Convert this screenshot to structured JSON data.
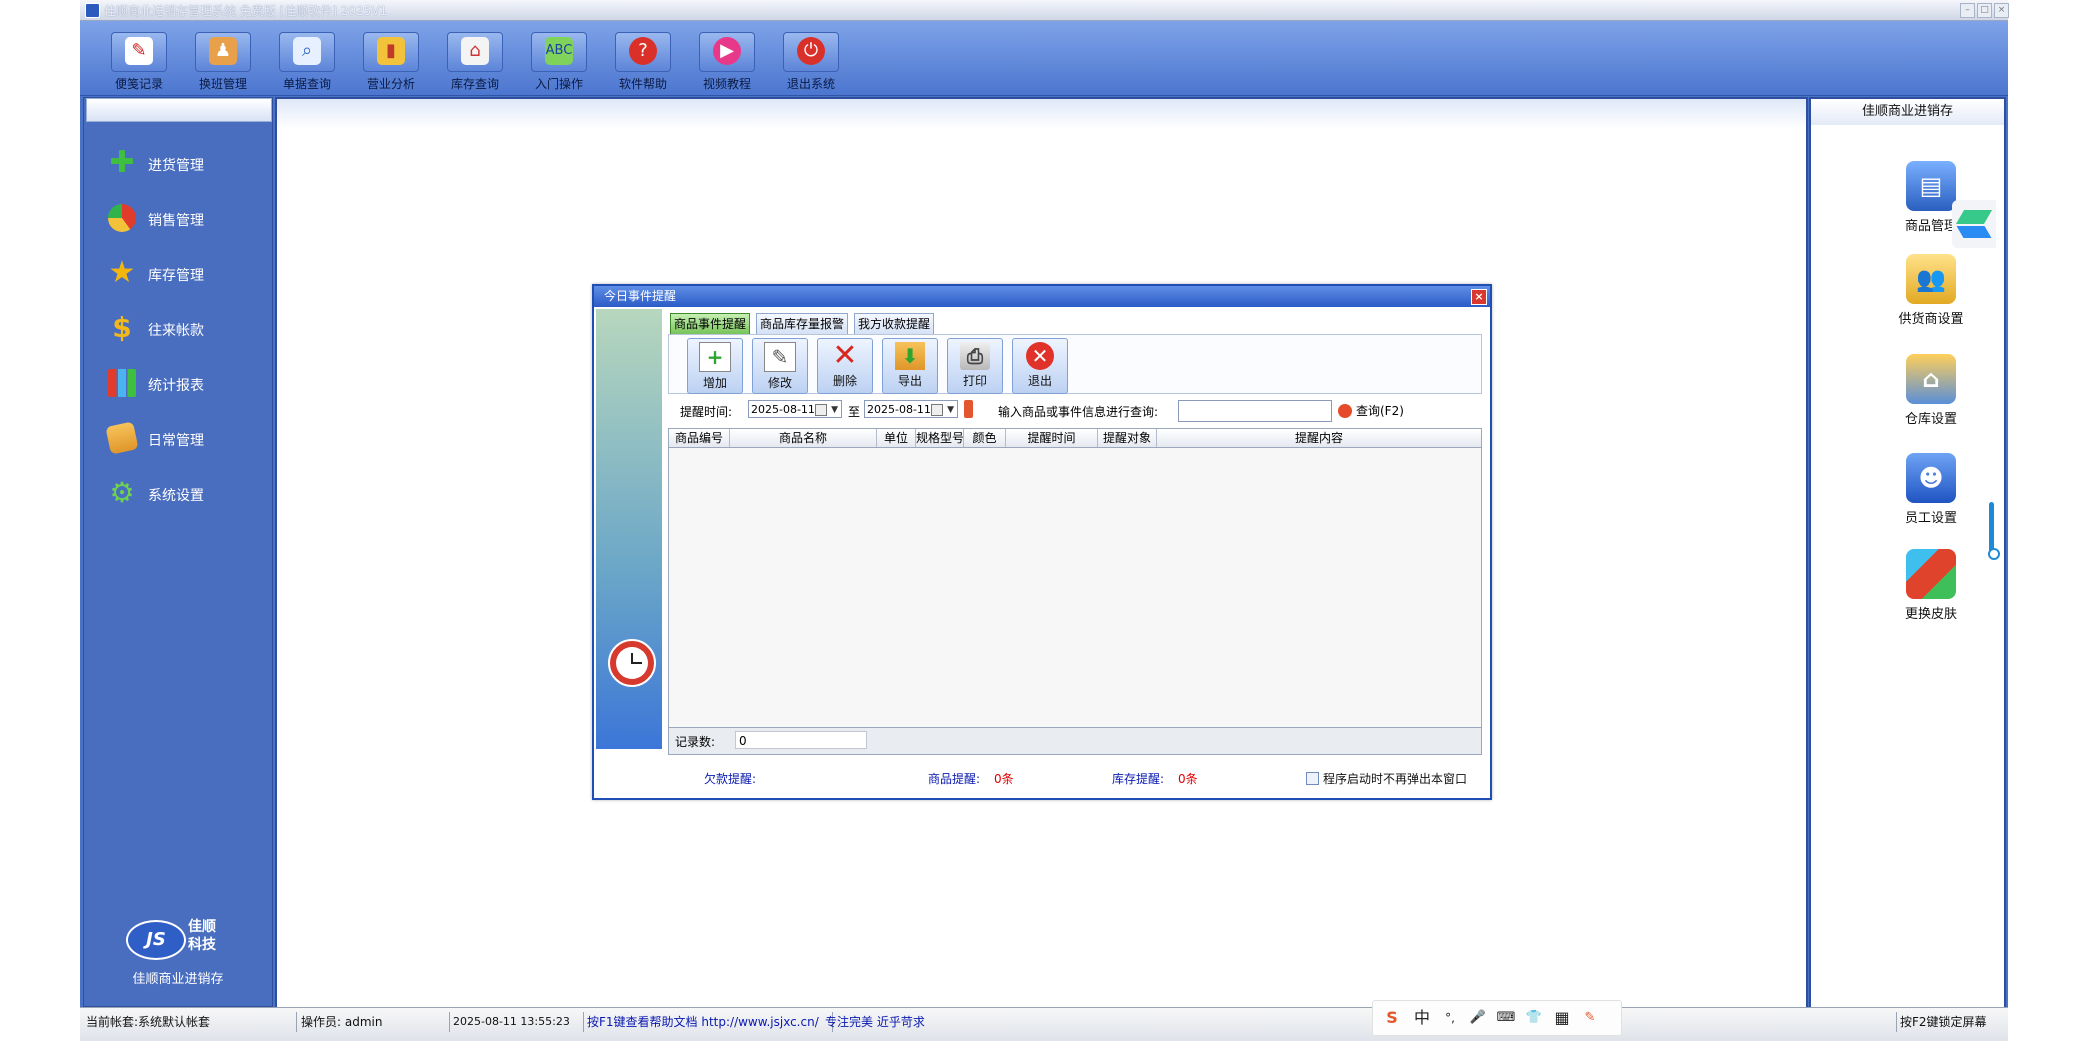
{
  "window": {
    "title": "佳顺商业进销存管理系统 免费版 [佳顺软件] 2025V1"
  },
  "toolbar": {
    "items": [
      {
        "label": "便笺记录",
        "icon": "memo-icon"
      },
      {
        "label": "换班管理",
        "icon": "shift-change-icon"
      },
      {
        "label": "单据查询",
        "icon": "magnifier-icon"
      },
      {
        "label": "营业分析",
        "icon": "bar-chart-icon"
      },
      {
        "label": "库存查询",
        "icon": "warehouse-icon"
      },
      {
        "label": "入门操作",
        "icon": "abc-icon"
      },
      {
        "label": "软件帮助",
        "icon": "help-icon"
      },
      {
        "label": "视频教程",
        "icon": "play-icon"
      },
      {
        "label": "退出系统",
        "icon": "power-icon"
      }
    ]
  },
  "nav": {
    "items": [
      {
        "label": "进货管理",
        "icon": "plus-icon"
      },
      {
        "label": "销售管理",
        "icon": "pie-icon"
      },
      {
        "label": "库存管理",
        "icon": "star-icon"
      },
      {
        "label": "往来帐款",
        "icon": "dollar-icon"
      },
      {
        "label": "统计报表",
        "icon": "bar-chart-icon"
      },
      {
        "label": "日常管理",
        "icon": "folder-icon"
      },
      {
        "label": "系统设置",
        "icon": "gear-icon"
      }
    ],
    "logo_text": "JS",
    "logo_name_1": "佳顺",
    "logo_name_2": "科技",
    "caption": "佳顺商业进销存"
  },
  "right_panel": {
    "title": "佳顺商业进销存",
    "items": [
      {
        "label": "商品管理",
        "icon": "books-icon"
      },
      {
        "label": "供货商设置",
        "icon": "people-icon"
      },
      {
        "label": "仓库设置",
        "icon": "house-gear-icon"
      },
      {
        "label": "员工设置",
        "icon": "employee-icon"
      },
      {
        "label": "更换皮肤",
        "icon": "cubes-icon"
      }
    ]
  },
  "dialog": {
    "title": "今日事件提醒",
    "tabs": [
      "商品事件提醒",
      "商品库存量报警",
      "我方收款提醒"
    ],
    "buttons": [
      {
        "label": "增加",
        "icon": "add-doc-icon"
      },
      {
        "label": "修改",
        "icon": "edit-doc-icon"
      },
      {
        "label": "删除",
        "icon": "delete-x-icon"
      },
      {
        "label": "导出",
        "icon": "export-icon"
      },
      {
        "label": "打印",
        "icon": "printer-icon"
      },
      {
        "label": "退出",
        "icon": "exit-icon"
      }
    ],
    "query": {
      "time_label": "提醒时间:",
      "date_from": "2025-08-11",
      "to_label": "至",
      "date_to": "2025-08-11",
      "search_label": "输入商品或事件信息进行查询:",
      "search_value": "",
      "search_button": "查询(F2)"
    },
    "columns": [
      "商品编号",
      "商品名称",
      "单位",
      "规格型号",
      "颜色",
      "提醒时间",
      "提醒对象",
      "提醒内容"
    ],
    "rows": [],
    "footer": {
      "count_label": "记录数:",
      "count_value": "0"
    },
    "bottom": {
      "debt_label": "欠款提醒:",
      "goods_label": "商品提醒:",
      "goods_value": "0条",
      "stock_label": "库存提醒:",
      "stock_value": "0条",
      "no_popup_label": "程序启动时不再弹出本窗口"
    }
  },
  "statusbar": {
    "account": "当前帐套:系统默认帐套",
    "operator": "操作员: admin",
    "datetime": "2025-08-11 13:55:23",
    "help": "按F1键查看帮助文档 http://www.jsjxc.cn/",
    "slogan": "专注完美 近乎苛求",
    "lock": "按F2键锁定屏幕"
  },
  "ime": {
    "items": [
      "S",
      "中",
      "°,",
      "🎤",
      "⌨",
      "👕",
      "▦",
      "✎"
    ]
  },
  "colors": {
    "frame_blue": "#4a73c8",
    "dialog_title": "#2b5bc6",
    "active_tab": "#77c35a",
    "alert_red": "#e00000"
  }
}
